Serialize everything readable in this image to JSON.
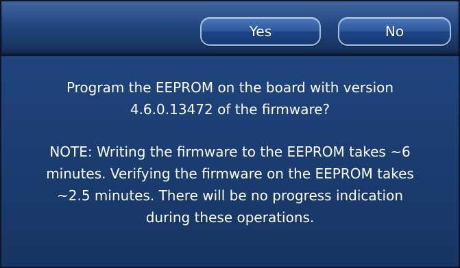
{
  "dialog": {
    "buttons": {
      "yes_label": "Yes",
      "no_label": "No"
    },
    "question": [
      "Program the EEPROM on the board with version",
      "4.6.0.13472 of the firmware?"
    ],
    "note": [
      "NOTE: Writing the firmware to the EEPROM takes ~6",
      "minutes. Verifying the firmware on the EEPROM takes",
      "~2.5 minutes. There will be no progress indication",
      "during these operations."
    ]
  },
  "colors": {
    "panel_blue": "#1d3f75",
    "toolbar_blue": "#244a86",
    "button_border": "#a9bfdf",
    "text": "#ffffff"
  }
}
